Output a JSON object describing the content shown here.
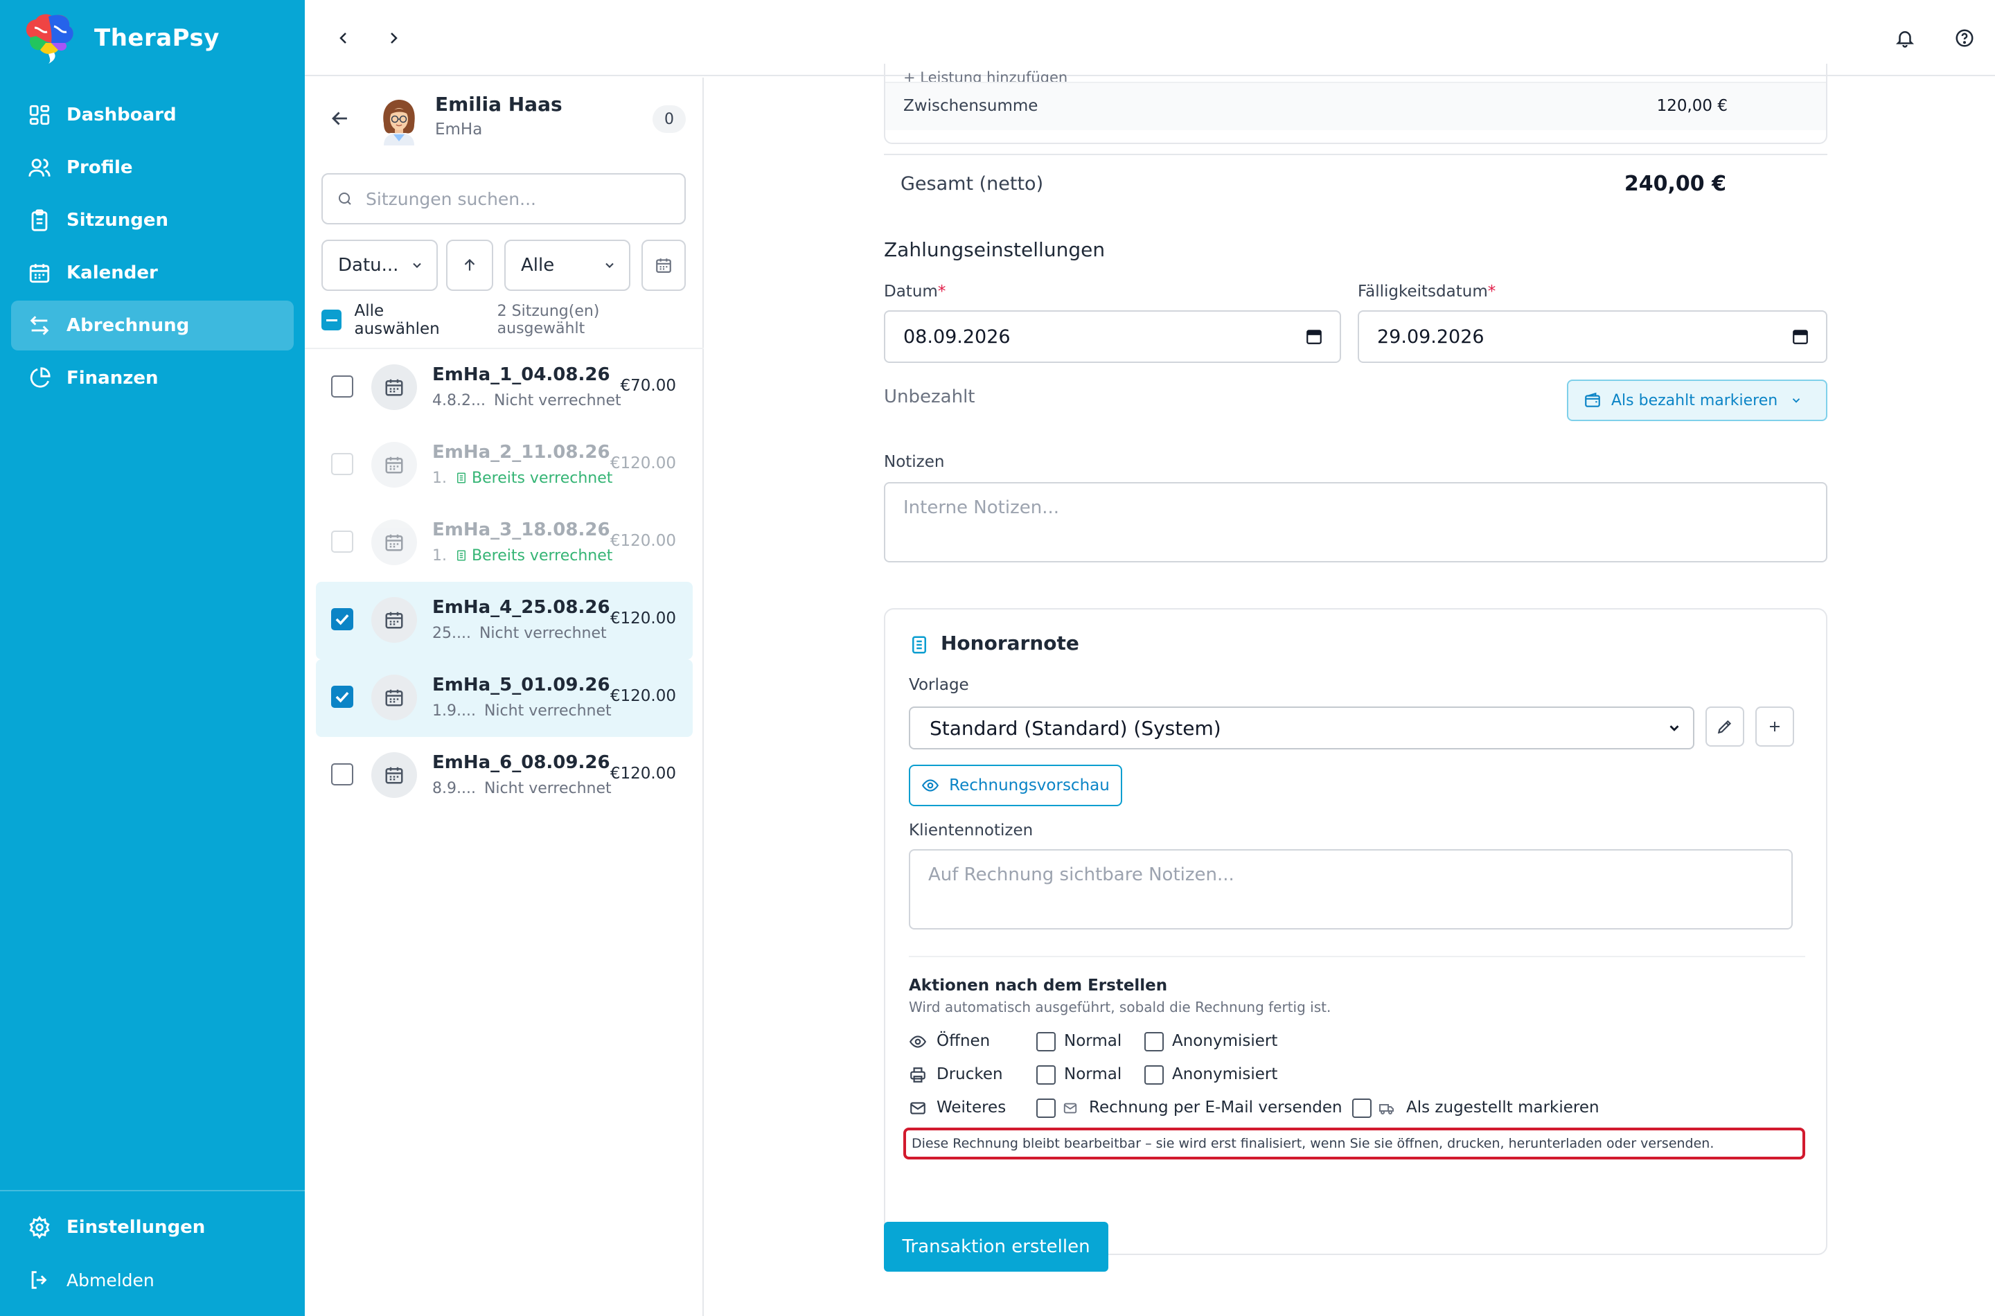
{
  "brand": {
    "name": "TheraPsy"
  },
  "sidebar": {
    "items": [
      {
        "label": "Dashboard",
        "icon": "dashboard-icon"
      },
      {
        "label": "Profile",
        "icon": "users-icon"
      },
      {
        "label": "Sitzungen",
        "icon": "clipboard-icon"
      },
      {
        "label": "Kalender",
        "icon": "calendar-icon"
      },
      {
        "label": "Abrechnung",
        "icon": "transfer-icon",
        "active": true
      },
      {
        "label": "Finanzen",
        "icon": "pie-chart-icon"
      }
    ],
    "settings": "Einstellungen",
    "logout": "Abmelden"
  },
  "client": {
    "name": "Emilia Haas",
    "short": "EmHa",
    "count": "0"
  },
  "list": {
    "search_placeholder": "Sitzungen suchen...",
    "sort_field": "Datu...",
    "status_filter": "Alle",
    "select_all": "Alle auswählen",
    "selected_count": "2 Sitzung(en) ausgewählt",
    "sessions": [
      {
        "title": "EmHa_1_04.08.26",
        "date": "4.8.2...",
        "status": "Nicht verrechnet",
        "price": "€70.00",
        "state": "unchecked"
      },
      {
        "title": "EmHa_2_11.08.26",
        "date": "1.",
        "status": "Bereits verrechnet",
        "price": "€120.00",
        "state": "disabled"
      },
      {
        "title": "EmHa_3_18.08.26",
        "date": "1.",
        "status": "Bereits verrechnet",
        "price": "€120.00",
        "state": "disabled"
      },
      {
        "title": "EmHa_4_25.08.26",
        "date": "25....",
        "status": "Nicht verrechnet",
        "price": "€120.00",
        "state": "checked"
      },
      {
        "title": "EmHa_5_01.09.26",
        "date": "1.9....",
        "status": "Nicht verrechnet",
        "price": "€120.00",
        "state": "checked"
      },
      {
        "title": "EmHa_6_08.09.26",
        "date": "8.9....",
        "status": "Nicht verrechnet",
        "price": "€120.00",
        "state": "unchecked"
      }
    ]
  },
  "form": {
    "add_service": "+ Leistung hinzufügen",
    "subtotal_label": "Zwischensumme",
    "subtotal_value": "120,00 €",
    "total_label": "Gesamt (netto)",
    "total_value": "240,00 €",
    "payment_title": "Zahlungseinstellungen",
    "date_label": "Datum",
    "date_value": "08.09.2026",
    "due_label": "Fälligkeitsdatum",
    "due_value": "29.09.2026",
    "paid_status": "Unbezahlt",
    "mark_paid": "Als bezahlt markieren",
    "notes_label": "Notizen",
    "notes_placeholder": "Interne Notizen...",
    "honor_title": "Honorarnote",
    "template_label": "Vorlage",
    "template_value": "Standard (Standard) (System)",
    "preview_btn": "Rechnungsvorschau",
    "client_notes_label": "Klientennotizen",
    "client_notes_placeholder": "Auf Rechnung sichtbare Notizen...",
    "actions_title": "Aktionen nach dem Erstellen",
    "actions_sub": "Wird automatisch ausgeführt, sobald die Rechnung fertig ist.",
    "open_label": "Öffnen",
    "print_label": "Drucken",
    "more_label": "Weiteres",
    "normal": "Normal",
    "anon": "Anonymisiert",
    "email_send": "Rechnung per E-Mail versenden",
    "mark_delivered": "Als zugestellt markieren",
    "note_text": "Diese Rechnung bleibt bearbeitbar – sie wird erst finalisiert, wenn Sie sie öffnen, drucken, herunterladen oder versenden.",
    "submit": "Transaktion erstellen"
  },
  "colors": {
    "primary": "#07a6d5",
    "highlight": "#d21a2e",
    "billed": "#34b474"
  }
}
